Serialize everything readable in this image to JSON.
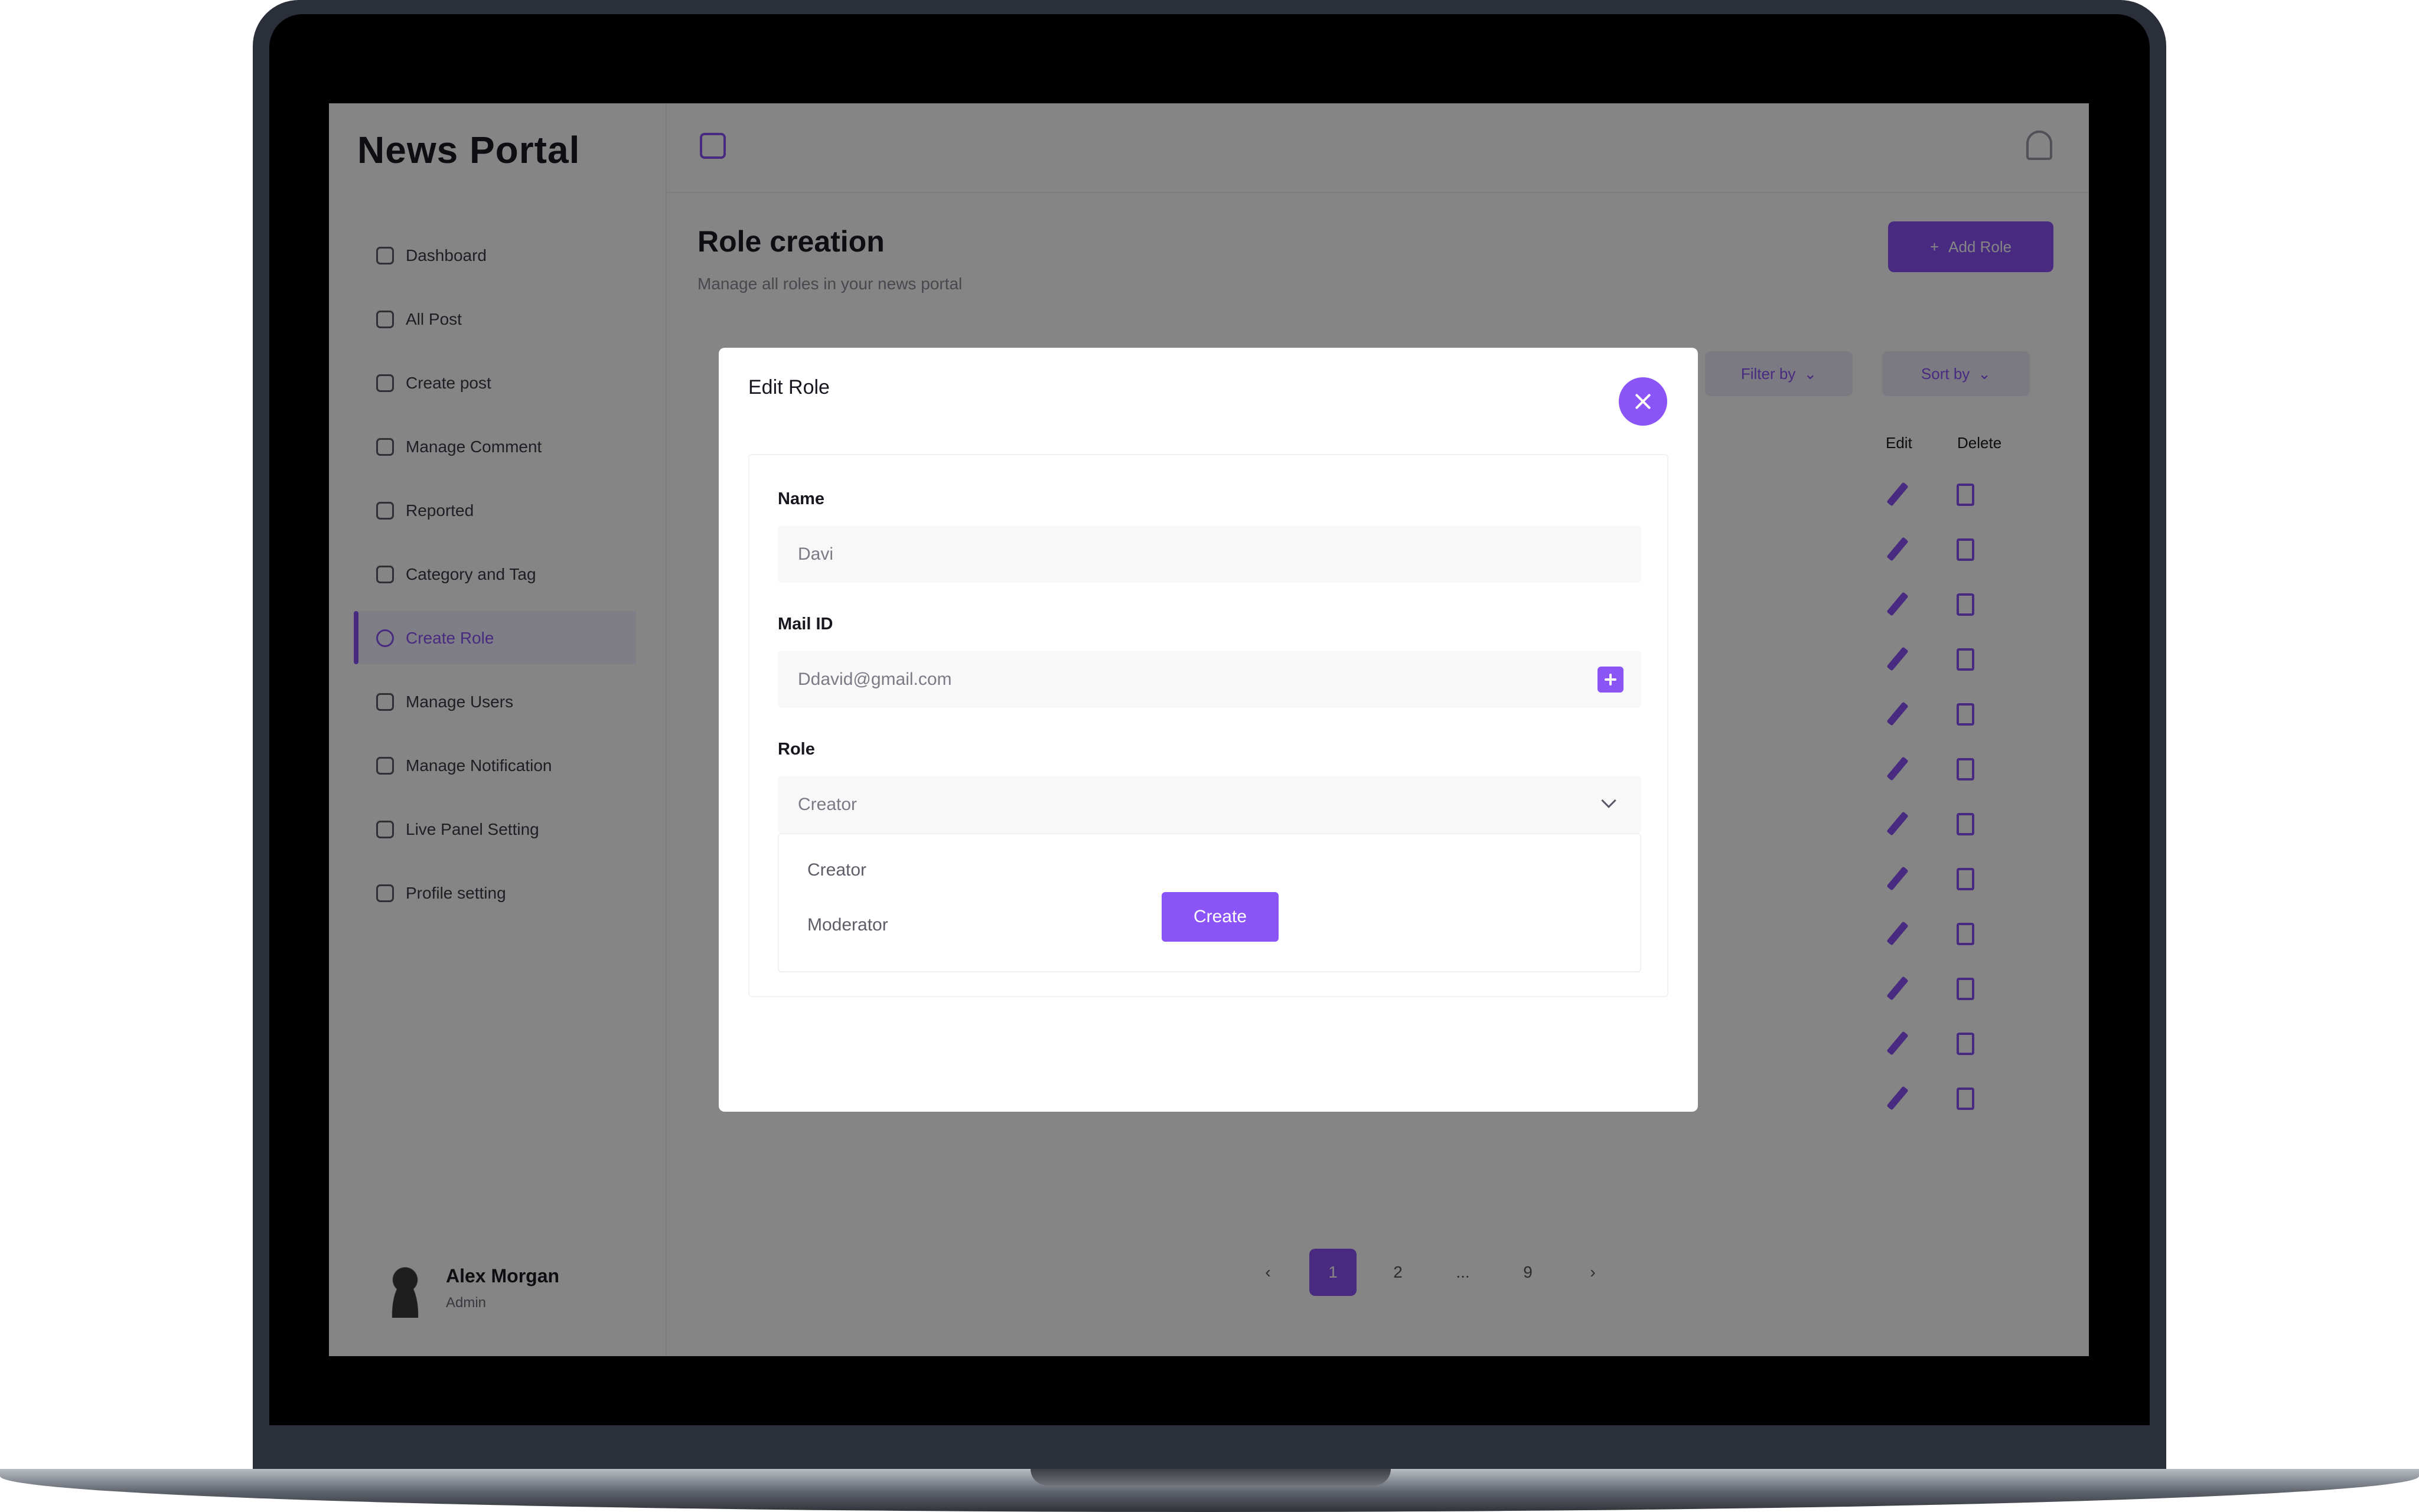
{
  "app": {
    "brand": "News Portal",
    "colors": {
      "accent": "#8b54f7",
      "overlay": "rgba(0,0,0,0.48)"
    }
  },
  "sidebar": {
    "items": [
      {
        "label": "Dashboard",
        "icon": "grid-icon"
      },
      {
        "label": "All Post",
        "icon": "file-icon"
      },
      {
        "label": "Create post",
        "icon": "plus-circle-icon"
      },
      {
        "label": "Manage Comment",
        "icon": "comment-icon"
      },
      {
        "label": "Reported",
        "icon": "flag-icon"
      },
      {
        "label": "Category and Tag",
        "icon": "tag-icon"
      },
      {
        "label": "Create Role",
        "icon": "user-icon",
        "active": true
      },
      {
        "label": "Manage Users",
        "icon": "users-icon"
      },
      {
        "label": "Manage Notification",
        "icon": "bell-icon"
      },
      {
        "label": "Live Panel Setting",
        "icon": "calendar-icon"
      },
      {
        "label": "Profile setting",
        "icon": "gear-icon"
      }
    ],
    "user": {
      "name": "Alex Morgan",
      "role": "Admin"
    }
  },
  "page": {
    "title": "Role creation",
    "subtitle": "Manage all roles in your news portal",
    "add_button": "Add Role",
    "filter_label": "Filter by",
    "sort_label": "Sort by",
    "columns": {
      "edit": "Edit",
      "delete": "Delete"
    },
    "pagination": [
      "1",
      "2",
      "...",
      "9"
    ]
  },
  "modal": {
    "title": "Edit Role",
    "name_label": "Name",
    "name_value": "Davi",
    "mail_label": "Mail ID",
    "mail_value": "Ddavid@gmail.com",
    "role_label": "Role",
    "role_value": "Creator",
    "role_options": [
      "Creator",
      "Moderator"
    ],
    "create_button": "Create"
  }
}
